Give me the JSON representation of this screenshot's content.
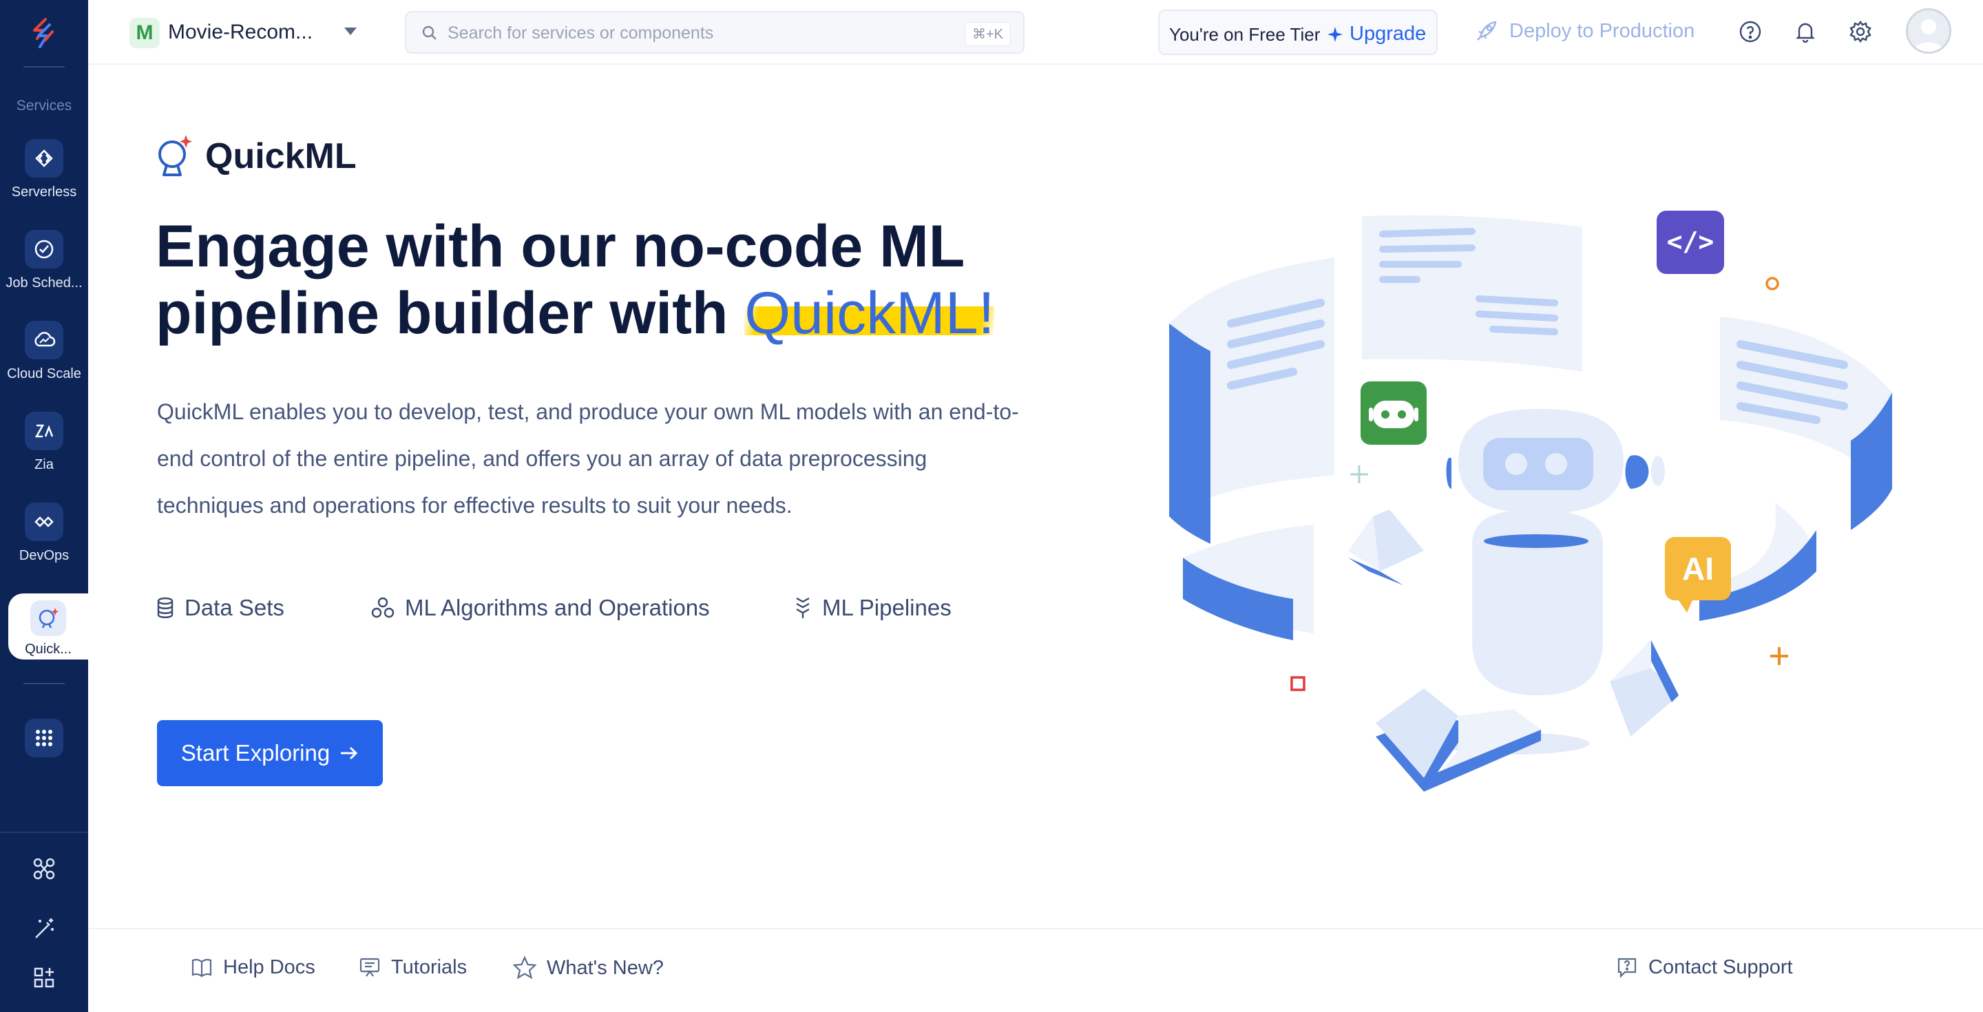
{
  "sidebar": {
    "section_label": "Services",
    "items": [
      {
        "label": "Serverless",
        "icon": "serverless-icon"
      },
      {
        "label": "Job Sched...",
        "icon": "job-scheduling-icon"
      },
      {
        "label": "Cloud Scale",
        "icon": "cloud-scale-icon"
      },
      {
        "label": "Zia",
        "icon": "zia-icon"
      },
      {
        "label": "DevOps",
        "icon": "devops-icon"
      },
      {
        "label": "Quick...",
        "icon": "quickml-icon",
        "active": true
      }
    ],
    "tools": [
      "all-services-grid-icon",
      "integrations-icon",
      "magic-wand-icon",
      "add-widget-icon"
    ]
  },
  "topbar": {
    "project_initial": "M",
    "project_name": "Movie-Recom...",
    "search_placeholder": "Search for services or components",
    "search_shortcut": "⌘+K",
    "tier_text": "You're on Free Tier",
    "upgrade_label": "Upgrade",
    "deploy_label": "Deploy to Production"
  },
  "hero": {
    "brand": "QuickML",
    "headline_part1": "Engage with our no-code ML pipeline builder with ",
    "headline_highlight": "QuickML!",
    "description": "QuickML enables you to develop, test, and produce your own ML models with an end-to-end control of the entire pipeline, and offers you an array of data preprocessing techniques and operations for effective results to suit your needs.",
    "features": [
      {
        "label": "Data Sets",
        "icon": "database-icon"
      },
      {
        "label": "ML Algorithms and Operations",
        "icon": "algorithms-icon"
      },
      {
        "label": "ML Pipelines",
        "icon": "pipeline-icon"
      }
    ],
    "cta_label": "Start Exploring",
    "illustration_badges": {
      "code": "</>",
      "ai": "AI"
    }
  },
  "footer": {
    "help_docs": "Help Docs",
    "tutorials": "Tutorials",
    "whats_new": "What's New?",
    "contact_support": "Contact Support"
  },
  "colors": {
    "sidebar_bg": "#0d2456",
    "accent": "#2563eb",
    "highlight": "#ffd600",
    "project_badge": "#2f9a46"
  }
}
